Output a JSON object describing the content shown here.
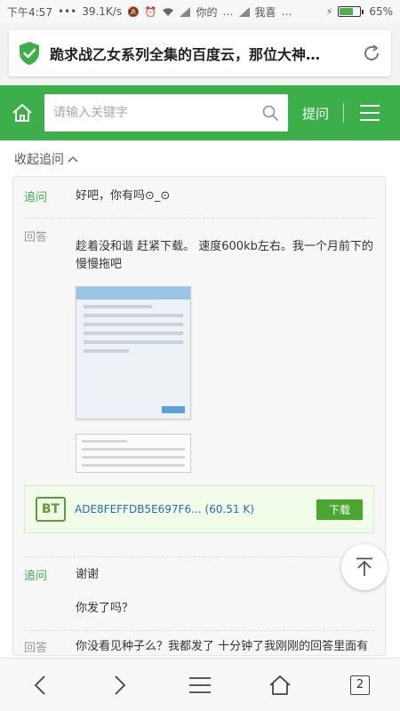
{
  "status_bar": {
    "time": "下午4:57",
    "dots": "•••",
    "speed": "39.1K/s",
    "carrier1": "你的",
    "carrier1_dots": "…",
    "carrier2": "我喜",
    "carrier2_dots": "…",
    "battery_percent": "65%",
    "battery_level": 0.65
  },
  "url_bar": {
    "title": "跪求战乙女系列全集的百度云，那位大神…",
    "secure_color": "#3caf4b"
  },
  "header": {
    "search_placeholder": "请输入关键字",
    "ask_label": "提问",
    "brand_color": "#3caf4b"
  },
  "collapse_label": "收起追问",
  "thread": [
    {
      "tag": "追问",
      "text": "好吧，你有吗⊙_⊙"
    },
    {
      "tag": "回答",
      "text": "趁着没和谐 赶紧下载。 速度600kb左右。我一个月前下的 慢慢拖吧"
    },
    {
      "tag": "追问",
      "text": "谢谢"
    },
    {
      "tag": "",
      "text": "你发了吗？"
    },
    {
      "tag": "回答",
      "text": "你没看见种子么？我都发了 十分钟了我刚刚的回答里面有啊 你看不到？？？"
    }
  ],
  "attachment": {
    "icon_label": "BT",
    "filename": "ADE8FEFFDB5E697F6...",
    "size": "(60.51 K)",
    "download_label": "下载"
  },
  "bottom_nav": {
    "tab_count": "2"
  }
}
